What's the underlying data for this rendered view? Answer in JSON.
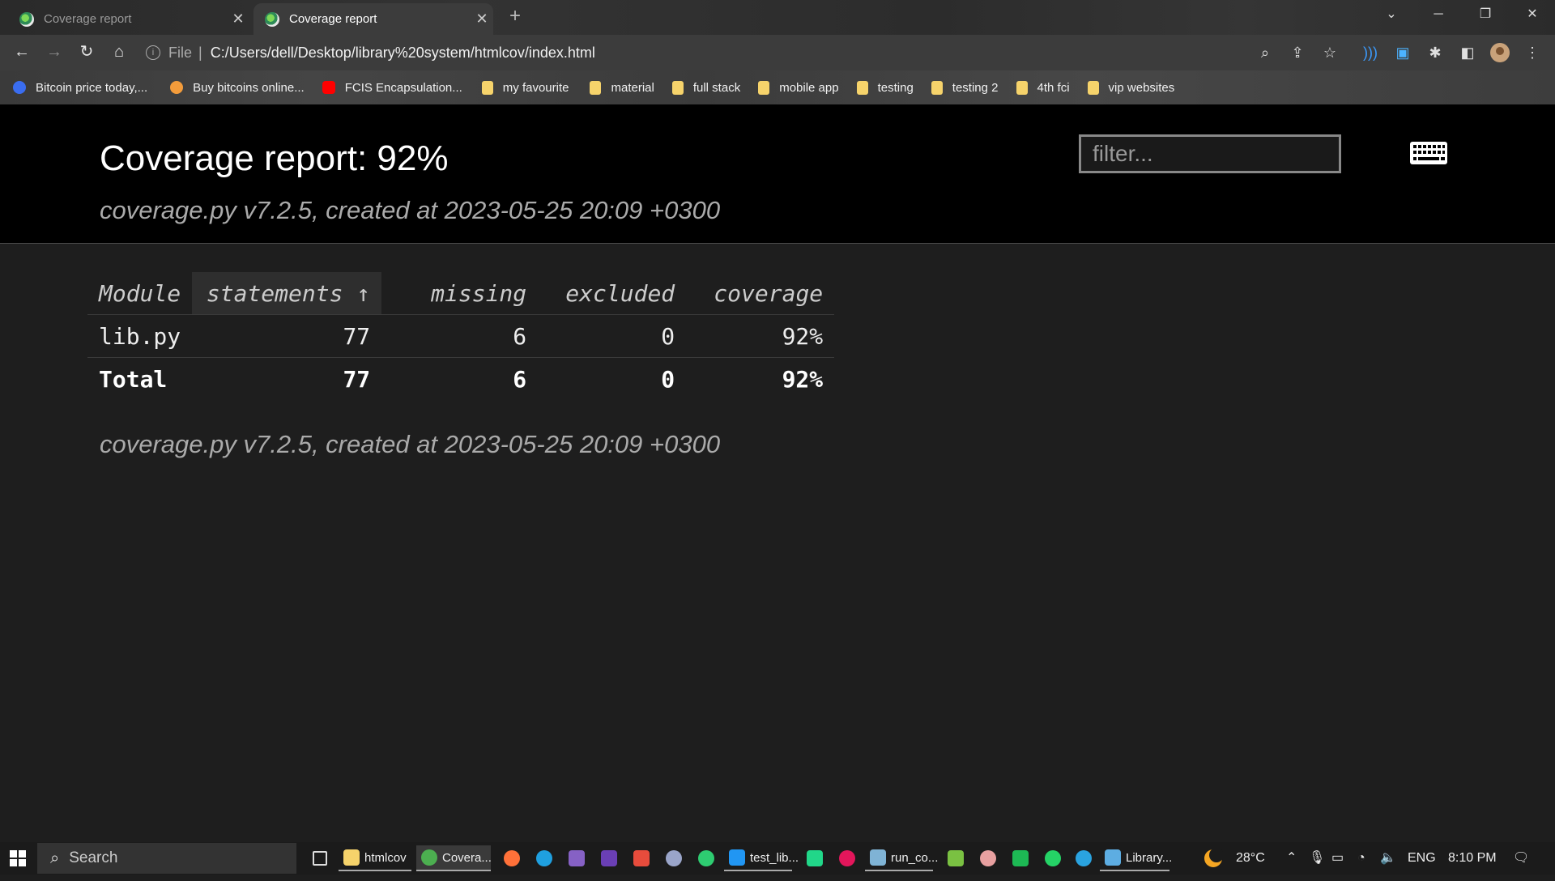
{
  "browser": {
    "tabs": [
      {
        "title": "Coverage report",
        "active": false
      },
      {
        "title": "Coverage report",
        "active": true
      }
    ],
    "new_tab": "+",
    "address": {
      "scheme": "File",
      "separator": "|",
      "url": "C:/Users/dell/Desktop/library%20system/htmlcov/index.html"
    },
    "bookmarks": [
      {
        "label": "Bitcoin price today,...",
        "icon": "circle-logo-icon",
        "color": "#3a6df0"
      },
      {
        "label": "Buy bitcoins online...",
        "icon": "bitcoin-icon",
        "color": "#f39c3b"
      },
      {
        "label": "FCIS Encapsulation...",
        "icon": "youtube-icon",
        "color": "#ff0000"
      },
      {
        "label": "my favourite",
        "icon": "folder-icon"
      },
      {
        "label": "material",
        "icon": "folder-icon"
      },
      {
        "label": "full stack",
        "icon": "folder-icon"
      },
      {
        "label": "mobile app",
        "icon": "folder-icon"
      },
      {
        "label": "testing",
        "icon": "folder-icon"
      },
      {
        "label": "testing 2",
        "icon": "folder-icon"
      },
      {
        "label": "4th fci",
        "icon": "folder-icon"
      },
      {
        "label": "vip websites",
        "icon": "folder-icon"
      }
    ]
  },
  "page": {
    "title": "Coverage report: 92%",
    "meta": "coverage.py v7.2.5, created at 2023-05-25 20:09 +0300",
    "filter_placeholder": "filter...",
    "table": {
      "headers": {
        "module": "Module",
        "statements": "statements",
        "sort_arrow": "↑",
        "missing": "missing",
        "excluded": "excluded",
        "coverage": "coverage"
      },
      "rows": [
        {
          "module": "lib.py",
          "statements": "77",
          "missing": "6",
          "excluded": "0",
          "coverage": "92%"
        }
      ],
      "total": {
        "module": "Total",
        "statements": "77",
        "missing": "6",
        "excluded": "0",
        "coverage": "92%"
      }
    },
    "footer_meta": "coverage.py v7.2.5, created at 2023-05-25 20:09 +0300"
  },
  "taskbar": {
    "search_label": "Search",
    "items": [
      {
        "label": "htmlcov",
        "icon": "folder-icon",
        "color": "#f6d36b"
      },
      {
        "label": "Covera...",
        "icon": "chrome-icon",
        "color": "#4caf50"
      },
      {
        "label": "test_lib...",
        "icon": "vscode-icon",
        "color": "#2196f3"
      },
      {
        "label": "run_co...",
        "icon": "notepad-icon",
        "color": "#7fb3d5"
      },
      {
        "label": "Library...",
        "icon": "feather-icon",
        "color": "#5dade2"
      }
    ],
    "weather": "28°C",
    "language": "ENG",
    "time": "8:10 PM"
  }
}
